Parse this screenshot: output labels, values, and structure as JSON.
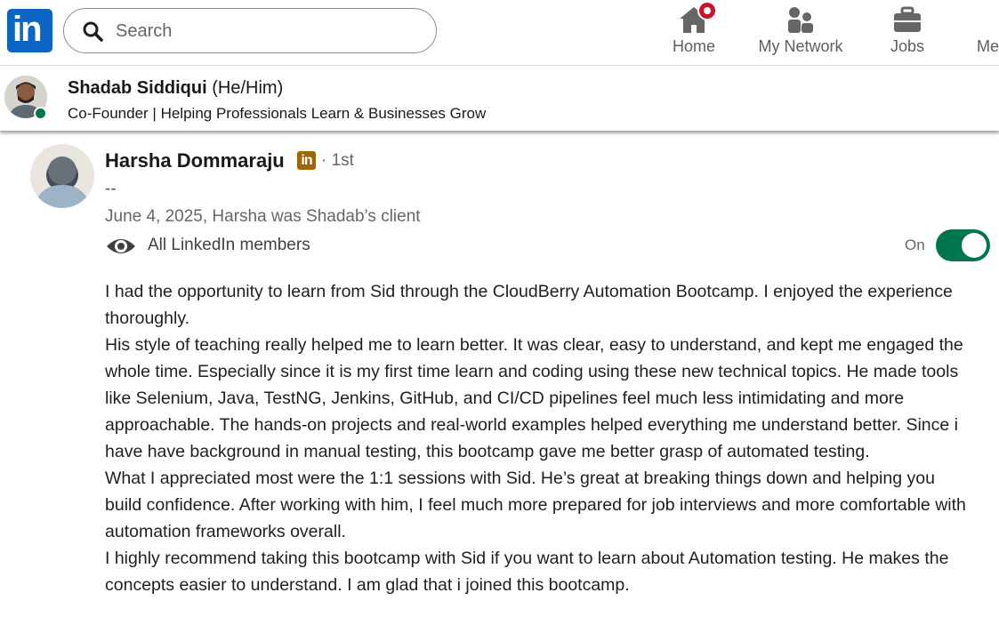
{
  "nav": {
    "search_placeholder": "Search",
    "items": [
      {
        "label": "Home",
        "icon": "home-icon",
        "notification": true
      },
      {
        "label": "My Network",
        "icon": "people-icon"
      },
      {
        "label": "Jobs",
        "icon": "briefcase-icon"
      },
      {
        "label": "Me",
        "icon": "avatar-icon"
      }
    ]
  },
  "profile": {
    "name": "Shadab Siddiqui",
    "pronouns": "(He/Him)",
    "headline": "Co-Founder | Helping Professionals Learn & Businesses Grow",
    "online": true
  },
  "recommendation": {
    "author_name": "Harsha Dommaraju",
    "badge": "in",
    "degree": "· 1st",
    "author_headline": "--",
    "date_relation": "June 4, 2025, Harsha was Shadab’s client",
    "visibility": "All LinkedIn members",
    "toggle_label": "On",
    "toggle_on": true,
    "paragraphs": [
      "I had the opportunity to learn from Sid through the CloudBerry Automation Bootcamp. I enjoyed the experience thoroughly.",
      "His style of teaching really helped me to learn better. It was clear, easy to understand, and kept me engaged the whole time. Especially since it is my first time learn and coding using these new technical topics. He made tools like Selenium, Java, TestNG, Jenkins, GitHub, and CI/CD pipelines feel much less intimidating and more approachable. The hands-on projects and real-world examples helped everything me understand better. Since i have have background in manual testing, this bootcamp gave me better grasp of automated testing.",
      "What I appreciated most were the 1:1 sessions with Sid. He’s great at breaking things down and helping you build confidence. After working with him, I feel much more prepared for job interviews and more comfortable with automation frameworks overall.",
      "I highly recommend taking this bootcamp with Sid if you want to learn about Automation testing. He makes the concepts easier to understand. I am glad that i joined this bootcamp."
    ]
  },
  "colors": {
    "brand": "#0a66c2",
    "toggle": "#01754f",
    "notification": "#cb112d",
    "badge": "#a0670a"
  }
}
